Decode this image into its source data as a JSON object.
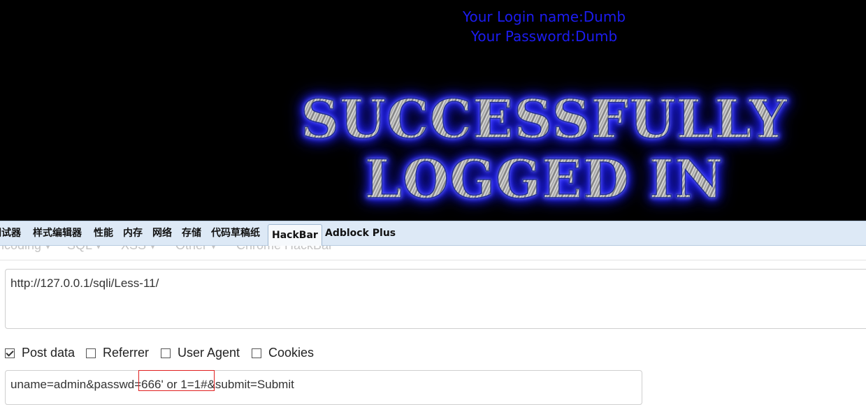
{
  "page": {
    "login_name": "Your Login name:Dumb",
    "password": "Your Password:Dumb",
    "banner_line1": "SUCCESSFULLY",
    "banner_line2": "LOGGED IN"
  },
  "devtools": {
    "tabs": [
      "调试器",
      "样式编辑器",
      "性能",
      "内存",
      "网络",
      "存储",
      "代码草稿纸",
      "HackBar",
      "Adblock Plus"
    ],
    "active_tab": "HackBar"
  },
  "hackbar": {
    "menu": [
      "ncoding ▾",
      "SQL ▾",
      "XSS ▾",
      "Other ▾",
      "Chrome HackBar"
    ],
    "url": "http://127.0.0.1/sqli/Less-11/",
    "options": [
      {
        "label": "Post data",
        "checked": true
      },
      {
        "label": "Referrer",
        "checked": false
      },
      {
        "label": "User Agent",
        "checked": false
      },
      {
        "label": "Cookies",
        "checked": false
      }
    ],
    "post_data": "uname=admin&passwd=666' or 1=1#&submit=Submit"
  },
  "colors": {
    "login_text": "#1c1cf0",
    "tabbar_bg": "#dde9f6",
    "highlight_border": "#e02020"
  }
}
